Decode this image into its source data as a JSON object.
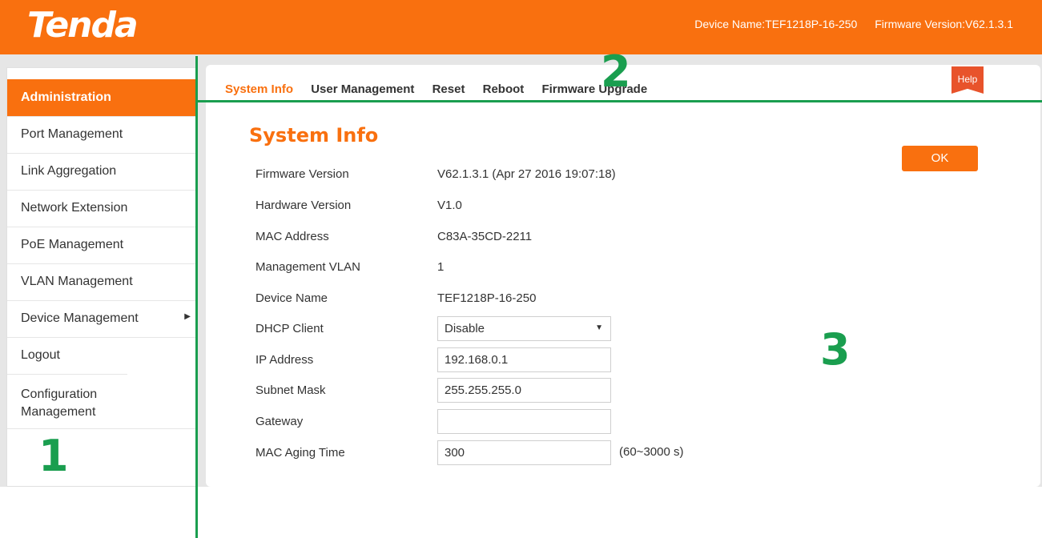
{
  "header": {
    "logo": "Tenda",
    "device_name": "Device Name:TEF1218P-16-250",
    "firmware_version": "Firmware Version:V62.1.3.1",
    "brand_color": "#f9700f"
  },
  "sidebar": {
    "items": [
      {
        "label": "Administration",
        "active": true
      },
      {
        "label": "Port Management"
      },
      {
        "label": "Link Aggregation"
      },
      {
        "label": "Network Extension"
      },
      {
        "label": "PoE Management"
      },
      {
        "label": "VLAN Management"
      },
      {
        "label": "Device Management",
        "arrow": "▶"
      },
      {
        "label": "Logout"
      },
      {
        "label": "Configuration Management"
      }
    ]
  },
  "tabs": [
    "System Info",
    "User Management",
    "Reset",
    "Reboot",
    "Firmware Upgrade"
  ],
  "help_label": "Help",
  "page": {
    "title": "System Info",
    "ok_label": "OK",
    "info": {
      "firmware_version": {
        "label": "Firmware Version",
        "value": "V62.1.3.1 (Apr 27 2016 19:07:18)"
      },
      "hardware_version": {
        "label": "Hardware Version",
        "value": "V1.0"
      },
      "mac_address": {
        "label": "MAC Address",
        "value": "C83A-35CD-2211"
      },
      "management_vlan": {
        "label": "Management VLAN",
        "value": "1"
      },
      "device_name": {
        "label": "Device Name",
        "value": "TEF1218P-16-250"
      }
    },
    "dhcp_client": {
      "label": "DHCP Client",
      "value": "Disable"
    },
    "ip_address": {
      "label": "IP Address",
      "value": "192.168.0.1"
    },
    "subnet_mask": {
      "label": "Subnet Mask",
      "value": "255.255.255.0"
    },
    "gateway": {
      "label": "Gateway",
      "value": ""
    },
    "mac_aging_time": {
      "label": "MAC Aging Time",
      "value": "300",
      "unit": "(60~3000 s)"
    }
  },
  "markers": {
    "m1": "1",
    "m2": "2",
    "m3": "3",
    "color": "#1a9e4f"
  }
}
